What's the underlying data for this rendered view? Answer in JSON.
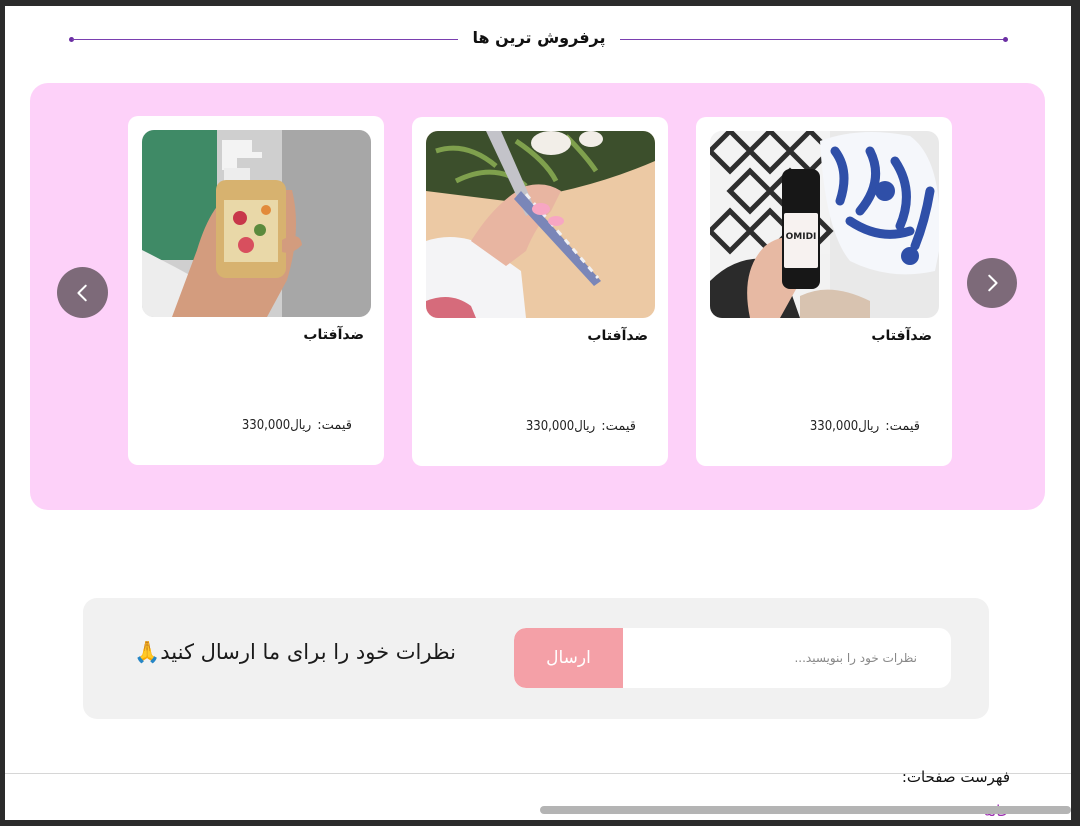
{
  "bestsellers": {
    "title": "پرفروش ترین ها",
    "accent_color": "#7a3fb0",
    "background_color": "#fdd1f9",
    "nav_prev_icon": "chevron-left-icon",
    "nav_next_icon": "chevron-right-icon",
    "products": [
      {
        "name": "ضدآفتاب",
        "price_label": "قیمت:",
        "price_value": "ریال330,000",
        "image": "serum-bottle-with-floral-bag"
      },
      {
        "name": "ضدآفتاب",
        "price_label": "قیمت:",
        "price_value": "ریال330,000",
        "image": "hand-holding-makeup-brush"
      },
      {
        "name": "ضدآفتاب",
        "price_label": "قیمت:",
        "price_value": "ریال330,000",
        "image": "hand-holding-soap-bottle"
      }
    ]
  },
  "feedback": {
    "prompt": "نظرات خود را برای  ما ارسال کنید🙏",
    "placeholder": "نظرات خود را بنویسید...",
    "send_label": "ارسال",
    "send_color": "#f4a0a7"
  },
  "footer": {
    "heading": "فهرست صفحات:",
    "links": [
      "خانه"
    ],
    "link_color": "#9b2fb0"
  }
}
